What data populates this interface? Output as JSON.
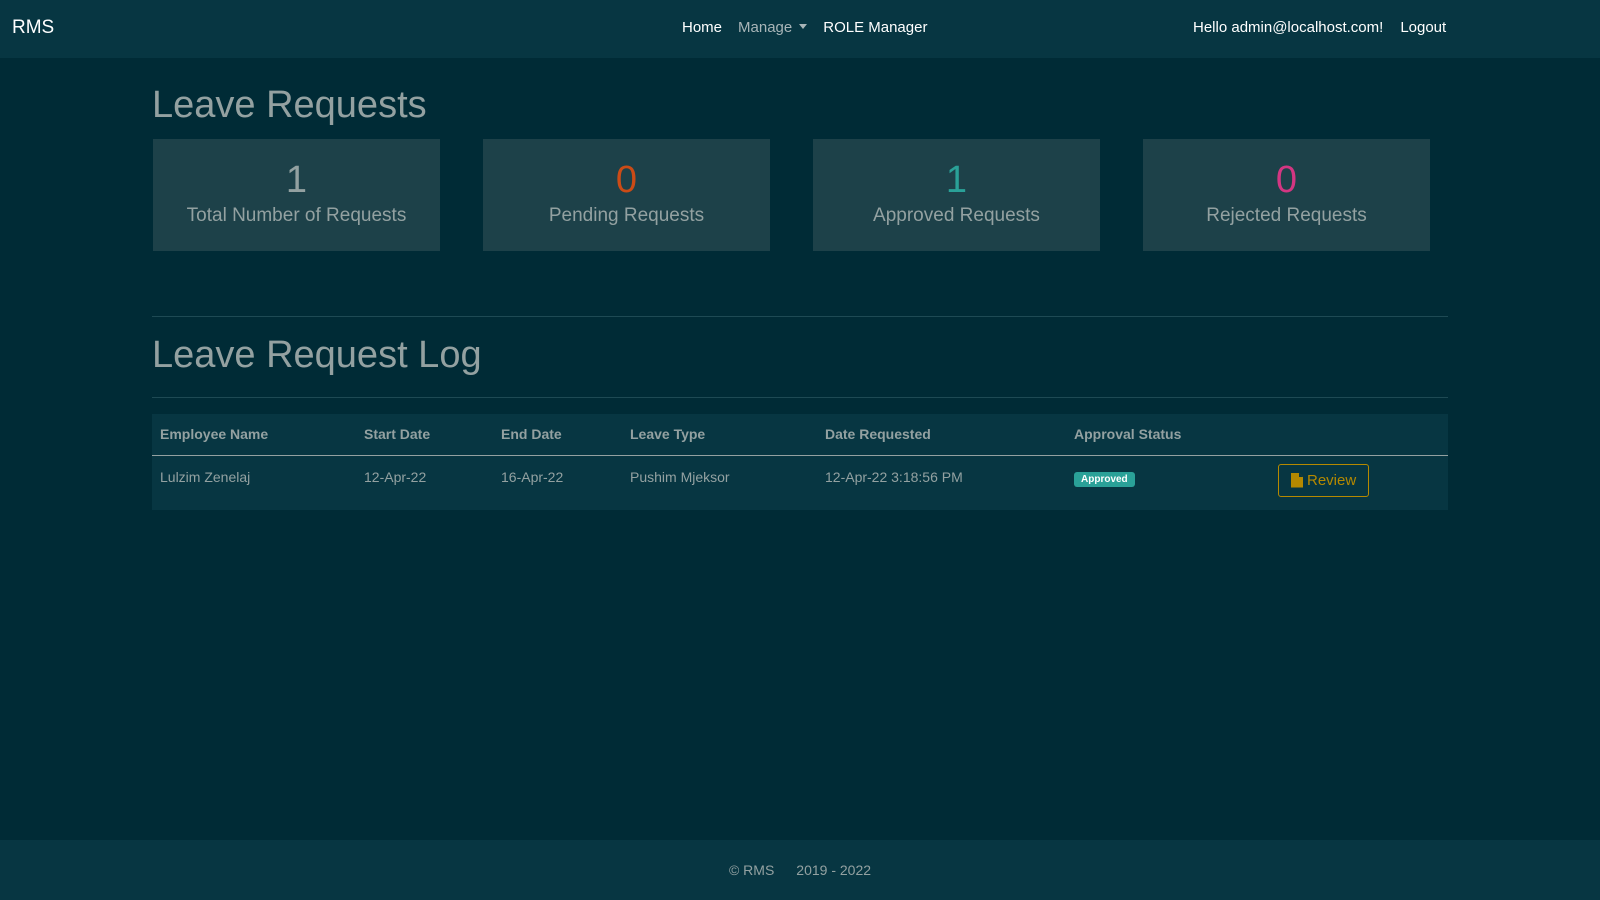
{
  "navbar": {
    "brand": "RMS",
    "links": [
      {
        "label": "Home"
      },
      {
        "label": "Manage"
      },
      {
        "label": "ROLE Manager"
      }
    ],
    "greeting": "Hello admin@localhost.com!",
    "logout": "Logout"
  },
  "page": {
    "title": "Leave Requests",
    "stats": [
      {
        "value": "1",
        "label": "Total Number of Requests",
        "color": "#93a1a1"
      },
      {
        "value": "0",
        "label": "Pending Requests",
        "color": "#cb4b16"
      },
      {
        "value": "1",
        "label": "Approved Requests",
        "color": "#2aa198"
      },
      {
        "value": "0",
        "label": "Rejected Requests",
        "color": "#d33682"
      }
    ],
    "log_title": "Leave Request Log"
  },
  "table": {
    "columns": [
      "Employee Name",
      "Start Date",
      "End Date",
      "Leave Type",
      "Date Requested",
      "Approval Status",
      ""
    ],
    "rows": [
      {
        "employee": "Lulzim Zenelaj",
        "start": "12-Apr-22",
        "end": "16-Apr-22",
        "type": "Pushim Mjeksor",
        "requested": "12-Apr-22 3:18:56 PM",
        "status": "Approved",
        "status_color": "#2aa198",
        "action": "Review"
      }
    ]
  },
  "footer": {
    "copyright": "© RMS",
    "years": "2019 - 2022"
  },
  "icons": {
    "review": "file-icon",
    "manage": "caret-down-icon"
  }
}
